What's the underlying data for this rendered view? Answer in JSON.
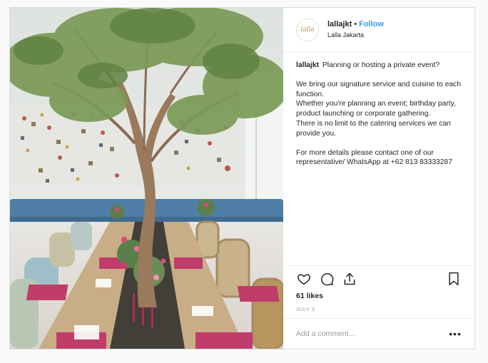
{
  "post": {
    "username": "lallajkt",
    "follow_label": "Follow",
    "location": "Lalla Jakarta",
    "avatar_text": "lalla",
    "caption": {
      "user": "lallajkt",
      "lines": [
        "Planning or hosting a private event?",
        "We bring our signature service and cuisine to each function.",
        "Whether you're planning an event; birthday party, product launching or corporate gathering.",
        "There is no limit to the catering services we can provide you.",
        "For more details please contact one of our representative/ WhatsApp at +62 813 83333287"
      ]
    },
    "likes": "61 likes",
    "date": "JULY 3",
    "comment_placeholder": "Add a comment...",
    "more_label": "•••"
  },
  "colors": {
    "accent": "#3897f0",
    "text": "#262626",
    "muted": "#999999",
    "border": "#dbdbdb"
  },
  "icons": [
    "heart-icon",
    "comment-icon",
    "share-icon",
    "bookmark-icon",
    "more-options-icon"
  ]
}
